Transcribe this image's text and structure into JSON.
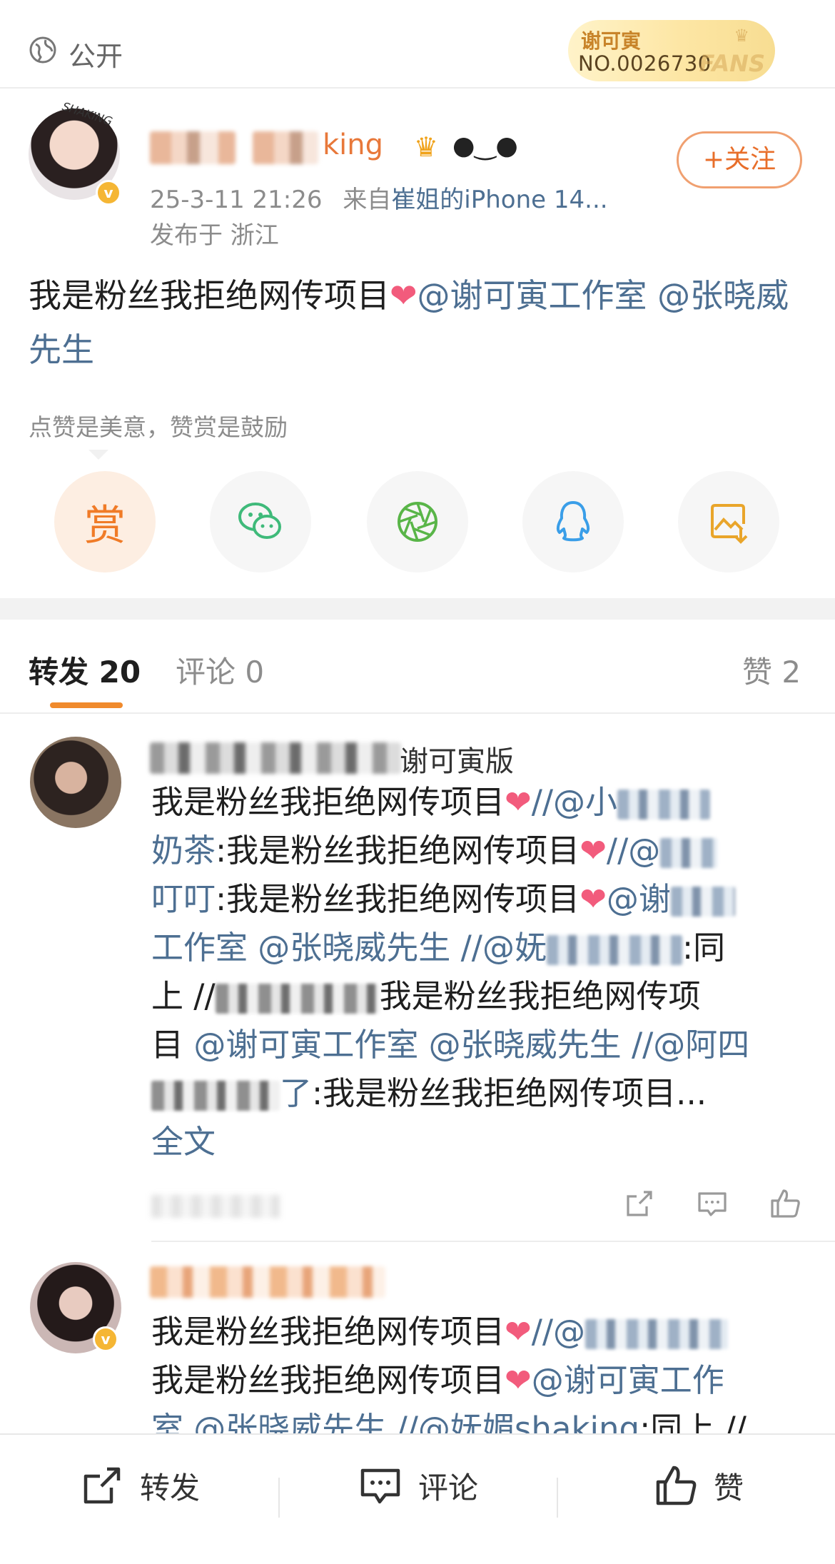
{
  "header": {
    "visibility": "公开",
    "fan_badge": {
      "name": "谢可寅",
      "number": "NO.0026730",
      "label": "FANS"
    }
  },
  "post": {
    "author_tail": "king",
    "avatar_tag": "SHAKING",
    "time": "25-3-11 21:26",
    "from_label": "来自",
    "source": "崔姐的iPhone 14...",
    "location": "发布于 浙江",
    "follow_label": "+关注",
    "text_main": "我是粉丝我拒绝网传项目",
    "mention_1": "@谢可寅工作室",
    "mention_2": "@张晓威先生",
    "reward_tip": "点赞是美意，赞赏是鼓励",
    "reward_button": "赏"
  },
  "tabs": {
    "repost": "转发 20",
    "comment": "评论 0",
    "like": "赞 2"
  },
  "reposts": [
    {
      "name_tail": "谢可寅版",
      "t1": "我是粉丝我拒绝网传项目",
      "t2": "//@小",
      "t3": "奶茶",
      "t4": ":我是粉丝我拒绝网传项目",
      "t5": "//@",
      "t6": "叮叮",
      "t7": ":我是粉丝我拒绝网传项目",
      "t8": "@谢",
      "t9": "工作室 @张晓威先生",
      "t10": "//@妩",
      "t11": ":同",
      "t12": "上 //",
      "t13": "我是粉丝我拒绝网传项",
      "t14": "目",
      "t15": "@谢可寅工作室",
      "t16": "@张晓威先生",
      "t17": "//@阿四",
      "t18": "了",
      "t19": ":我是粉丝我拒绝网传项目...",
      "full_text": "全文"
    },
    {
      "t1": "我是粉丝我拒绝网传项目",
      "t2": "//@",
      "t3": "我是粉丝我拒绝网传项目",
      "t4": "@谢可寅工作",
      "t5": "室 @张晓威先生 //@妩媚shaking",
      "t6": ":同上 //"
    }
  ],
  "bottom_bar": {
    "repost": "转发",
    "comment": "评论",
    "like": "赞"
  },
  "colors": {
    "link": "#4d6f92",
    "accent_orange": "#f08a2c",
    "heart": "#f25b7c"
  }
}
